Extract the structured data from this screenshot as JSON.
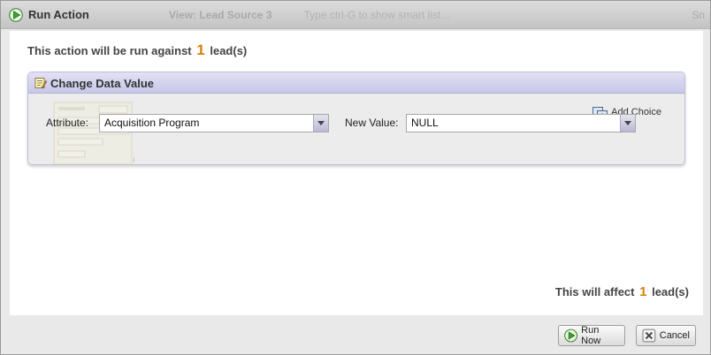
{
  "window": {
    "title": "Run Action",
    "background_title": "View: Lead Source 3",
    "background_hint": "Type ctrl-G to show smart list...",
    "background_right": "Sn"
  },
  "summary": {
    "prefix": "This action will be run against",
    "count": "1",
    "suffix": "lead(s)"
  },
  "panel": {
    "title": "Change Data Value",
    "add_choice_label": "Add Choice",
    "attribute_label": "Attribute:",
    "attribute_value": "Acquisition Program",
    "new_value_label": "New Value:",
    "new_value_value": "NULL"
  },
  "affect": {
    "prefix": "This will affect",
    "count": "1",
    "suffix": "lead(s)"
  },
  "buttons": {
    "run_now": "Run Now",
    "cancel": "Cancel"
  },
  "colors": {
    "accent_count": "#d4820a",
    "panel_header": "#c8c7e8",
    "play_green": "#3aa630"
  },
  "icons": [
    "play-icon",
    "edit-icon",
    "add-choice-icon",
    "run-icon",
    "cancel-icon"
  ]
}
